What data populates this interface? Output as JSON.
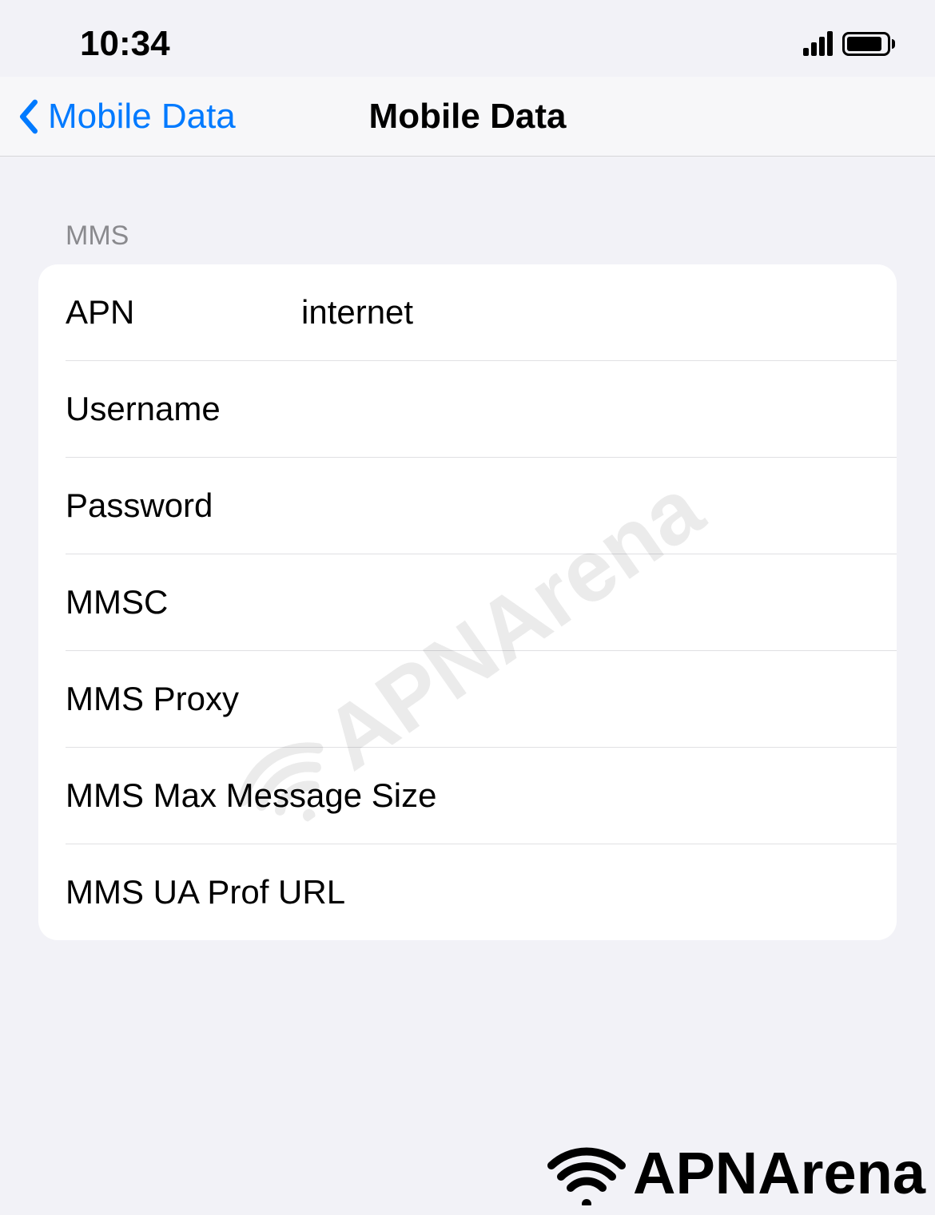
{
  "status": {
    "time": "10:34"
  },
  "nav": {
    "back_label": "Mobile Data",
    "title": "Mobile Data"
  },
  "section": {
    "header": "MMS"
  },
  "fields": {
    "apn": {
      "label": "APN",
      "value": "internet"
    },
    "username": {
      "label": "Username",
      "value": ""
    },
    "password": {
      "label": "Password",
      "value": ""
    },
    "mmsc": {
      "label": "MMSC",
      "value": ""
    },
    "mms_proxy": {
      "label": "MMS Proxy",
      "value": ""
    },
    "mms_max": {
      "label": "MMS Max Message Size",
      "value": ""
    },
    "mms_ua": {
      "label": "MMS UA Prof URL",
      "value": ""
    }
  },
  "watermark": "APNArena",
  "brand": "APNArena"
}
